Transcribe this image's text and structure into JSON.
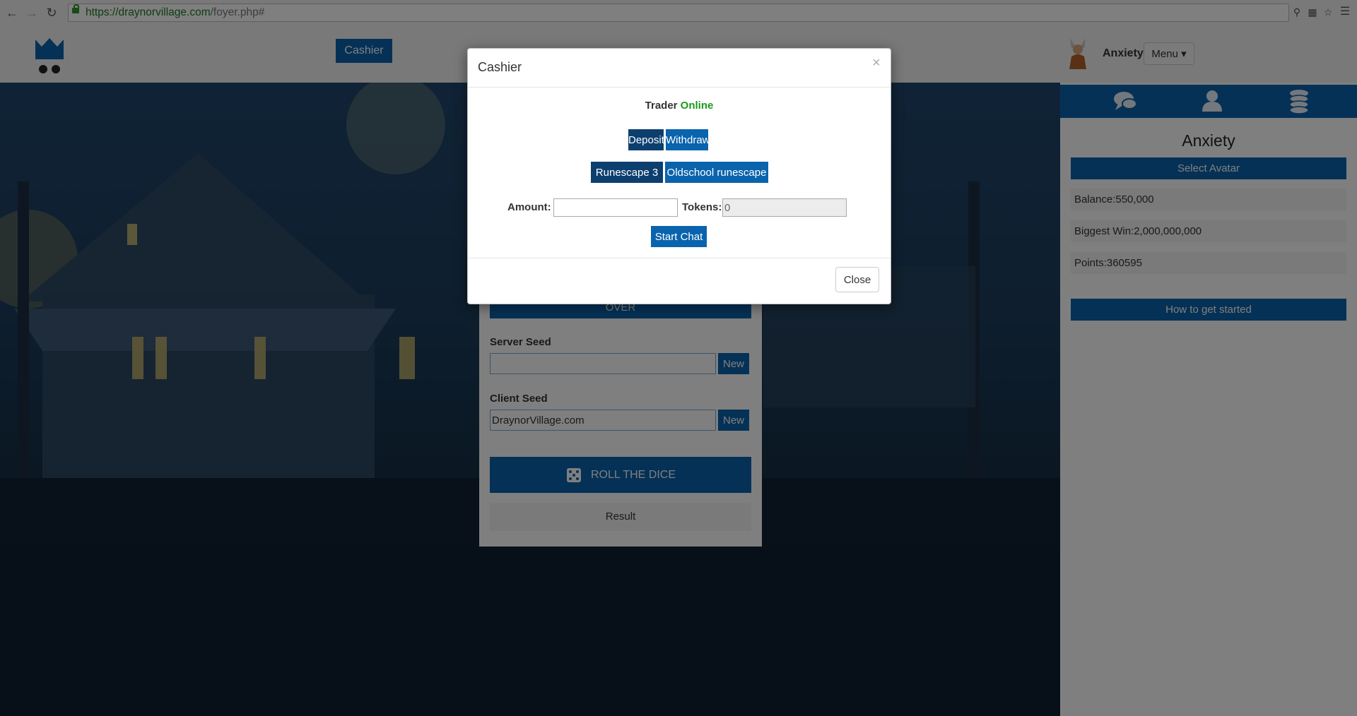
{
  "browser": {
    "url_scheme_host": "https://draynorvillage.com",
    "url_path": "/foyer.php#"
  },
  "header": {
    "cashier_label": "Cashier",
    "ticker_text": "",
    "username": "Anxiety",
    "menu_label": "Menu ▾"
  },
  "game": {
    "over_label": "OVER",
    "server_seed_label": "Server Seed",
    "server_seed_value": "",
    "client_seed_label": "Client Seed",
    "client_seed_value": "DraynorVillage.com",
    "new_label": "New",
    "roll_label": "ROLL THE DICE",
    "result_label": "Result"
  },
  "sidebar": {
    "profile_name": "Anxiety",
    "select_avatar_label": "Select Avatar",
    "balance": "Balance:550,000",
    "biggest_win": "Biggest Win:2,000,000,000",
    "points": "Points:360595",
    "how_to_label": "How to get started"
  },
  "modal": {
    "title": "Cashier",
    "close_x": "×",
    "trader_label": "Trader",
    "trader_status": "Online",
    "deposit_label": "Deposit",
    "withdraw_label": "Withdraw",
    "rs3_label": "Runescape 3",
    "osrs_label": "Oldschool runescape",
    "amount_label": "Amount:",
    "amount_value": "",
    "tokens_label": "Tokens:",
    "tokens_value": "0",
    "start_chat_label": "Start Chat",
    "close_label": "Close"
  },
  "colors": {
    "primary_blue": "#0a63ad",
    "selected_dark_blue": "#0c3f6e",
    "online_green": "#1a9a1a"
  }
}
